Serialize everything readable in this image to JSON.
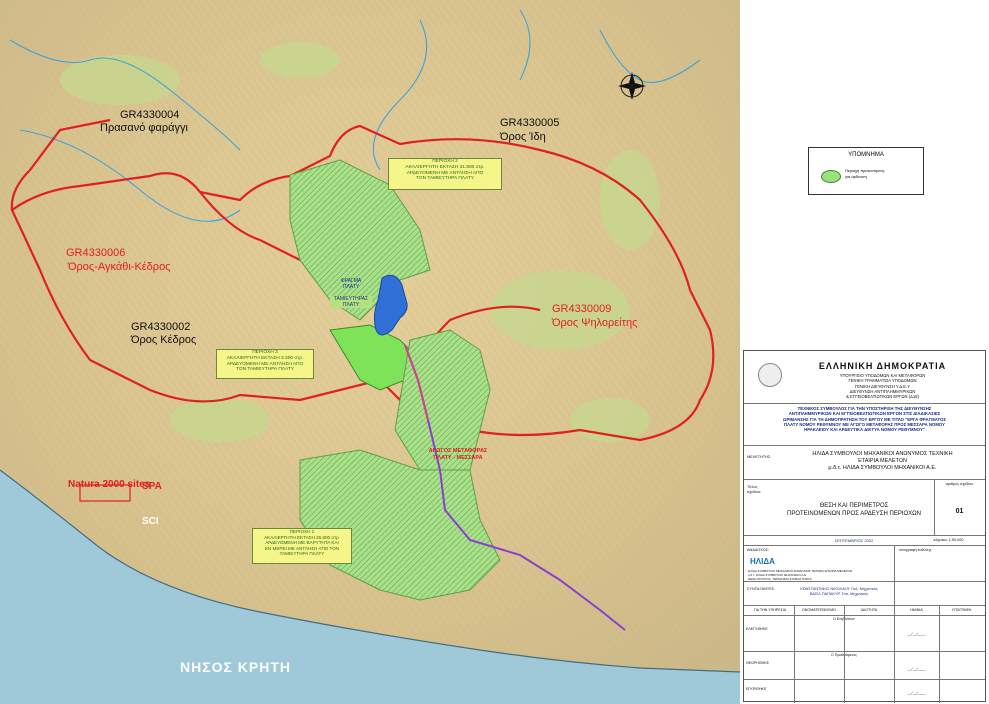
{
  "map": {
    "natura_zones": [
      {
        "code": "GR4330004",
        "name": "Πρασανό φαράγγι"
      },
      {
        "code": "GR4330005",
        "name": "Όρος Ίδη"
      },
      {
        "code": "GR4330006",
        "name": "Όρος-Αγκάθι-Κέδρος"
      },
      {
        "code": "GR4330002",
        "name": "Όρος Κέδρος"
      },
      {
        "code": "GR4330009",
        "name": "Όρος Ψηλορείτης"
      }
    ],
    "areas": [
      {
        "id": "area2",
        "text": "ΠΕΡΙΟΧΗ 2\nΑΚΑΛΙΕΡΓΗΤΗ ΕΚΤΑΣΗ 31.600 στρ.\nΑΡΔΕΥΟΜΕΝΗ ΜΕ ΑΝΤΛΗΣΗ ΑΠΟ\nΤΟΝ ΤΑΜΙΕΥΤΗΡΑ ΠΛΑΤΥ"
      },
      {
        "id": "area3",
        "text": "ΠΕΡΙΟΧΗ 3\nΑΚΑΛΙΕΡΓΗΤΗ ΕΚΤΑΣΗ 3.300 στρ.\nΑΡΔΕΥΟΜΕΝΗ ΜΕ ΑΝΤΛΗΣΗ ΑΠΟ\nΤΟΝ ΤΑΜΙΕΥΤΗΡΑ ΠΛΑΤΥ"
      },
      {
        "id": "area1",
        "text": "ΠΕΡΙΟΧΗ 1\nΑΚΑΛΙΕΡΓΗΤΗ ΕΚΤΑΣΗ 26.600 στρ.\nΑΡΔΕΥΟΜΕΝΗ ΜΕ ΒΑΡΥΤΗΤΑ ΚΑΙ\nΕΝ ΜΕΡΕΙ ΜΕ ΑΝΤΛΗΣΗ ΑΠΟ ΤΟΝ\nΤΑΜΙΕΥΤΗΡΑ ΠΛΑΤΥ"
      }
    ],
    "reservoir_label": "ΤΑΜΙΕΥΤΗΡΑΣ\nΠΛΑΤΥ",
    "dam_label": "ΦΡΑΓΜΑ\nΠΛΑΤΥ",
    "pipeline_label": "ΑΓΩΓΟΣ ΜΕΤΑΦΟΡΑΣ\nΠΛΑΤΥ - ΜΕΣΣΑΡΑ",
    "natura_sites": "Natura 2000 sites",
    "spa": "SPA",
    "sci": "SCI",
    "island": "ΝΗΣΟΣ ΚΡΗΤΗ",
    "compass_icon": "compass-rose"
  },
  "legend": {
    "title": "ΥΠΟΜΝΗΜΑ",
    "item": "Περιοχή προτεινόμενη\nγια άρδευση"
  },
  "title_block": {
    "republic": "ΕΛΛΗΝΙΚΗ ΔΗΜΟΚΡΑΤΙΑ",
    "ministry": "ΥΠΟΥΡΓΕΙΟ ΥΠΟΔΟΜΩΝ ΚΑΙ ΜΕΤΑΦΟΡΩΝ\nΓΕΝΙΚΗ ΓΡΑΜΜΑΤΕΙΑ ΥΠΟΔΟΜΩΝ\nΓΕΝΙΚΗ ΔΙΕΥΘΥΝΣΗ Υ.Δ.Ε.Υ\nΔΙΕΥΘΥΝΣΗ ΑΝΤΙΠΛΗΜΜΥΡΙΚΩΝ\n& ΕΓΓΕΙΟΒΕΛΤΙΩΤΙΚΩΝ ΕΡΓΩΝ (Δ19)",
    "project": "ΤΕΧΝΙΚΟΣ ΣΥΜΒΟΥΛΟΣ ΓΙΑ ΤΗΝ ΥΠΟΣΤΗΡΙΞΗ ΤΗΣ ΔΙΕΥΘΥΝΣΗΣ\nΑΝΤΙΠΛΗΜΜΥΡΙΚΩΝ ΚΑΙ ΕΓΓΕΙΟΒΕΛΤΙΩΤΙΚΩΝ ΕΡΓΩΝ ΣΤΙΣ ΔΙΑΔΙΚΑΣΙΕΣ\nΩΡΙΜΑΝΣΗΣ ΓΙΑ ΤΗ ΔΗΜΟΠΡΑΤΗΣΗ ΤΟΥ ΕΡΓΟΥ ΜΕ ΤΙΤΛΟ \"ΕΡΓΑ ΦΡΑΓΜΑΤΟΣ\nΠΛΑΤΥ ΝΟΜΟΥ ΡΕΘΥΜΝΟΥ ΜΕ ΑΓΩΓΟ ΜΕΤΑΦΟΡΑΣ ΠΡΟΣ ΜΕΣΣΑΡΑ ΝΟΜΟΥ\nΗΡΑΚΛΕΙΟΥ ΚΑΙ ΑΡΔΕΥΤΙΚΑ ΔΙΚΤΥΑ ΝΟΜΟΥ ΡΕΘΥΜΝΟΥ\"",
    "study_label": "ΜΕΛΕΤΗΤΗΣ:",
    "consultant": "ΗΛΙΔΑ ΣΥΜΒΟΥΛΟΙ ΜΗΧΑΝΙΚΟΙ ΑΝΩΝΥΜΟΣ ΤΕΧΝΙΚΗ\nΕΤΑΙΡΙΑ ΜΕΛΕΤΩΝ\nμ.δ.τ. ΗΛΙΔΑ ΣΥΜΒΟΥΛΟΙ ΜΗΧΑΝΙΚΟΙ Α.Ε.",
    "drawing_title_label": "Τίτλος\nσχεδίου:",
    "drawing_title": "ΘΕΣΗ ΚΑΙ ΠΕΡΙΜΕΤΡΟΣ\nΠΡΟΤΕΙΝΟΜΕΝΩΝ ΠΡΟΣ ΑΡΔΕΥΣΗ ΠΕΡΙΟΧΩΝ",
    "drawing_no_label": "αριθμός σχεδίου",
    "drawing_no": "01",
    "date": "ΣΕΠΤΕΜΒΡΙΟΣ 2022",
    "scale": "κλίμακα: 1:50.000",
    "company_label": "ΑΝΑΔΟΧΟΣ:",
    "company_logo": "ΗΛΙΔΑ",
    "company_details": "ΗΛΙΔΑ ΣΥΜΒΟΥΛΟΙ ΜΗΧΑΝΙΚΟΙ ΑΝΩΝΥΜΟΣ ΤΕΧΝΙΚΗ ΕΤΑΙΡΙΑ ΜΕΛΕΤΩΝ\nμ.δ.τ. ΗΛΙΔΑ ΣΥΜΒΟΥΛΟΙ ΜΗΧΑΝΙΚΟΙ Α.Ε.\nΘΕΣΗ ΣΤΑΥΡΟΣ, ΤΕΡΜΑ ΒΑΣ.ΣΟΦΙΑΣ ΠΑΡΓΑ",
    "signature_label": "υπογραφή ευθύνης",
    "compilers_label": "ΣΥΝΤΑΞΑΝΤΕΣ:",
    "compilers": "ΚΩΝΣΤΑΝΤΙΝΟΣ ΝΙΚΟΛΑΟΥ   Πολ. Μηχανικός\nΒΑΣΙΛ.ΠΑΠΑΚΥΡ.   Τοπ. Μηχανικός",
    "table_headers": [
      "ΓΙΑ ΤΗΝ ΥΠΗΡΕΣΙΑ",
      "ΟΝΟΜΑΤΕΠΩΝΥΜΟ",
      "ΙΔΙΟΤΗΤΑ",
      "ΗΜ/ΝΙΑ",
      "ΥΠΟΓΡΑΦΗ"
    ],
    "row_labels": [
      "ΕΛΕΓΧΘΗΚΕ",
      "ΘΕΩΡΗΘΗΚΕ",
      "ΕΓΚΡΙΘΗΚΕ"
    ],
    "row_roles": [
      "Ο Επιβλέπων",
      "Ο Προϊστάμενος",
      ""
    ],
    "date_placeholder": "__/__/____"
  },
  "colors": {
    "boundary": "#e02020",
    "irrigation_fill": "#9be07a",
    "reservoir": "#2f6fd6",
    "pipeline": "#8a3fd1",
    "sea": "#9fc9d8",
    "land": "#e8d9b0"
  }
}
